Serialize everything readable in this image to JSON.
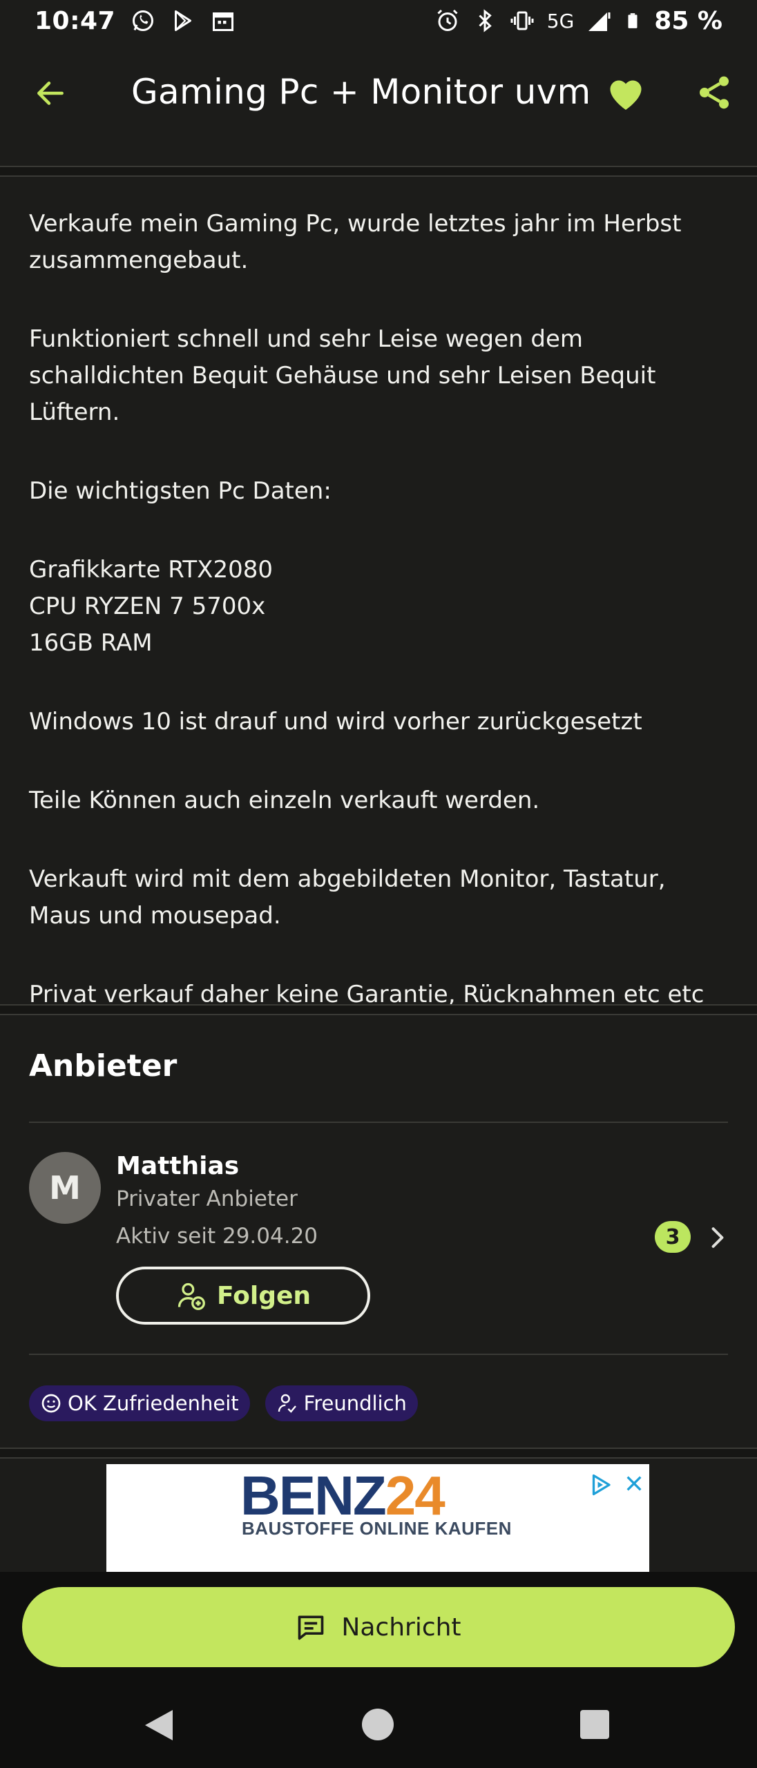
{
  "status_bar": {
    "time": "10:47",
    "network": "5G",
    "battery": "85 %"
  },
  "header": {
    "title": "Gaming Pc + Monitor uvm"
  },
  "description": {
    "paragraphs": [
      "Verkaufe mein Gaming Pc, wurde letztes jahr im Herbst zusammengebaut.",
      "Funktioniert schnell und sehr Leise wegen dem schalldichten Bequit Gehäuse und sehr Leisen Bequit Lüftern.",
      "Die wichtigsten Pc Daten:",
      "Grafikkarte RTX2080",
      "CPU RYZEN 7 5700x",
      "16GB RAM",
      "Windows 10 ist drauf und wird vorher zurückgesetzt",
      "Teile Können auch einzeln verkauft werden.",
      "Verkauft wird mit dem abgebildeten Monitor, Tastatur, Maus und mousepad.",
      "Privat verkauf daher keine Garantie, Rücknahmen etc etc"
    ]
  },
  "seller": {
    "section_title": "Anbieter",
    "avatar_initial": "M",
    "name": "Matthias",
    "type": "Privater Anbieter",
    "active_since": "Aktiv seit 29.04.20",
    "listing_count": "3",
    "follow_label": "Folgen",
    "tags": [
      "OK Zufriedenheit",
      "Freundlich"
    ]
  },
  "ad": {
    "brand_part1": "BENZ",
    "brand_part2": "24",
    "tagline": "BAUSTOFFE ONLINE KAUFEN"
  },
  "actions": {
    "message_label": "Nachricht"
  },
  "colors": {
    "background": "#1c1c1a",
    "accent": "#c3e65e",
    "tag_bg": "#2a1a5e"
  }
}
